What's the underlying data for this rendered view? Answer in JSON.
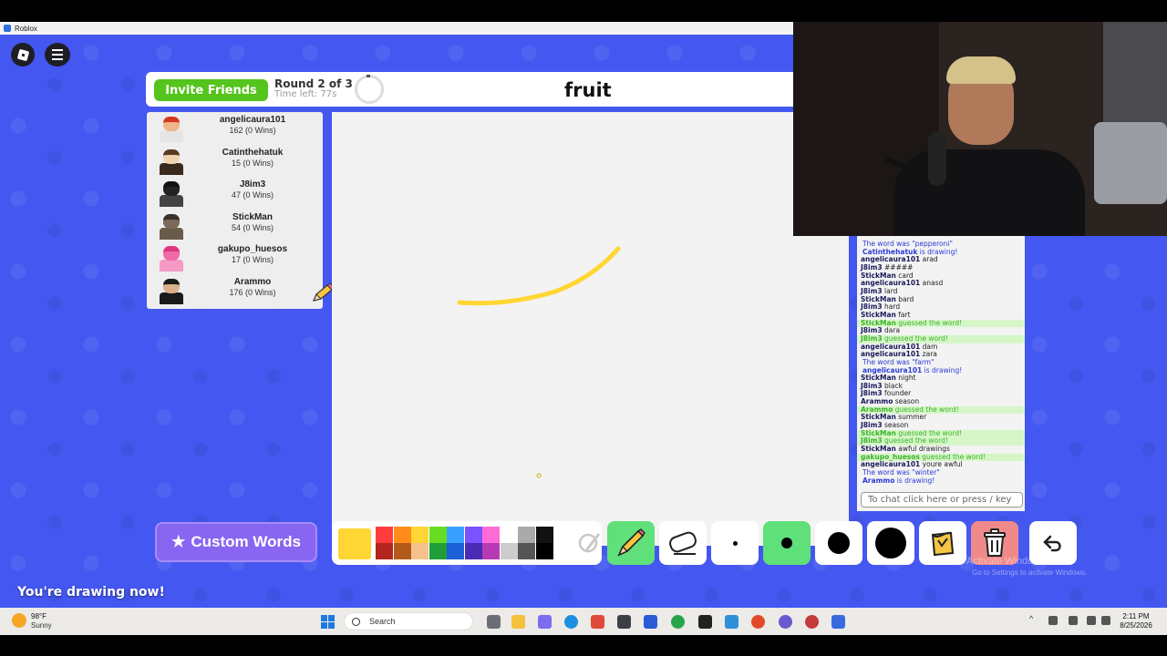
{
  "window": {
    "title": "Roblox"
  },
  "topbar": {
    "invite_label": "Invite Friends",
    "round": "Round 2 of 3",
    "time_left": "Time left: 77s",
    "word": "fruit"
  },
  "players": [
    {
      "name": "angelicaura101",
      "score": "162 (0 Wins)",
      "skin": "#f0b48a",
      "hair": "#d13a1a",
      "shirt": "#e5e5e5"
    },
    {
      "name": "Catinthehatuk",
      "score": "15 (0 Wins)",
      "skin": "#f2d3b0",
      "hair": "#5a3a1e",
      "shirt": "#3a2a1e"
    },
    {
      "name": "J8im3",
      "score": "47 (0 Wins)",
      "skin": "#222222",
      "hair": "#111111",
      "shirt": "#444444"
    },
    {
      "name": "StickMan",
      "score": "54 (0 Wins)",
      "skin": "#7a6a5a",
      "hair": "#3a2f2a",
      "shirt": "#6a5a4a"
    },
    {
      "name": "gakupo_huesos",
      "score": "17 (0 Wins)",
      "skin": "#f06aa8",
      "hair": "#e0357f",
      "shirt": "#f59ac4"
    },
    {
      "name": "Arammo",
      "score": "176 (0 Wins)",
      "skin": "#d9b08a",
      "hair": "#1a1a1a",
      "shirt": "#1a1a1a"
    }
  ],
  "chat": {
    "messages": [
      {
        "kind": "sys",
        "who": "",
        "text": "The word was \"pepperoni\""
      },
      {
        "kind": "sys",
        "who": "Catinthehatuk",
        "text": "is drawing!"
      },
      {
        "kind": "msg",
        "who": "angelicaura101",
        "text": "arad"
      },
      {
        "kind": "msg",
        "who": "J8im3",
        "text": "#####"
      },
      {
        "kind": "msg",
        "who": "StickMan",
        "text": "card"
      },
      {
        "kind": "msg",
        "who": "angelicaura101",
        "text": "anasd"
      },
      {
        "kind": "msg",
        "who": "J8im3",
        "text": "lard"
      },
      {
        "kind": "msg",
        "who": "StickMan",
        "text": "bard"
      },
      {
        "kind": "msg",
        "who": "J8im3",
        "text": "hard"
      },
      {
        "kind": "msg",
        "who": "StickMan",
        "text": "fart"
      },
      {
        "kind": "guess",
        "who": "StickMan",
        "text": "guessed the word!"
      },
      {
        "kind": "msg",
        "who": "J8im3",
        "text": "dara"
      },
      {
        "kind": "guess",
        "who": "J8im3",
        "text": "guessed the word!"
      },
      {
        "kind": "msg",
        "who": "angelicaura101",
        "text": "dam"
      },
      {
        "kind": "msg",
        "who": "angelicaura101",
        "text": "zara"
      },
      {
        "kind": "sys",
        "who": "",
        "text": "The word was \"farm\""
      },
      {
        "kind": "sys",
        "who": "angelicaura101",
        "text": "is drawing!"
      },
      {
        "kind": "msg",
        "who": "StickMan",
        "text": "night"
      },
      {
        "kind": "msg",
        "who": "J8im3",
        "text": "black"
      },
      {
        "kind": "msg",
        "who": "J8im3",
        "text": "founder"
      },
      {
        "kind": "msg",
        "who": "Arammo",
        "text": "season"
      },
      {
        "kind": "guess",
        "who": "Arammo",
        "text": "guessed the word!"
      },
      {
        "kind": "msg",
        "who": "StickMan",
        "text": "summer"
      },
      {
        "kind": "msg",
        "who": "J8im3",
        "text": "season"
      },
      {
        "kind": "guess",
        "who": "StickMan",
        "text": "guessed the word!"
      },
      {
        "kind": "guess",
        "who": "J8im3",
        "text": "guessed the word!"
      },
      {
        "kind": "msg",
        "who": "StickMan",
        "text": "awful drawings"
      },
      {
        "kind": "guess",
        "who": "gakupo_huesos",
        "text": "guessed the word!"
      },
      {
        "kind": "msg",
        "who": "angelicaura101",
        "text": "youre awful"
      },
      {
        "kind": "sys",
        "who": "",
        "text": "The word was \"winter\""
      },
      {
        "kind": "sys",
        "who": "Arammo",
        "text": "is drawing!"
      }
    ],
    "input_placeholder": "To chat click here or press / key"
  },
  "toolbar": {
    "custom_words_label": "Custom Words",
    "current_color": "#ffd633",
    "palette": [
      "#ff3b3b",
      "#ff8c1a",
      "#ffd633",
      "#66dd22",
      "#3aa0ff",
      "#7b52ff",
      "#ff6bd6",
      "#ffffff",
      "#aaaaaa",
      "#111111",
      "#b3261e",
      "#b35a1a",
      "#f5c28c",
      "#1f9e3a",
      "#1c5fd6",
      "#4a2bb5",
      "#b83ab5",
      "#cccccc",
      "#555555",
      "#000000"
    ],
    "brush_sizes": [
      "small",
      "medium",
      "large",
      "xlarge"
    ],
    "icons": [
      "pencil-icon",
      "eraser-icon",
      "fill-bucket-icon",
      "trash-icon",
      "undo-icon"
    ]
  },
  "status": {
    "drawing_now": "You're drawing now!"
  },
  "watermark": {
    "line1": "Activate Windows",
    "line2": "Go to Settings to activate Windows."
  },
  "taskbar": {
    "temp": "98°F",
    "condition": "Sunny",
    "search_label": "Search",
    "time": "2:11 PM",
    "date": "8/25/2026"
  }
}
